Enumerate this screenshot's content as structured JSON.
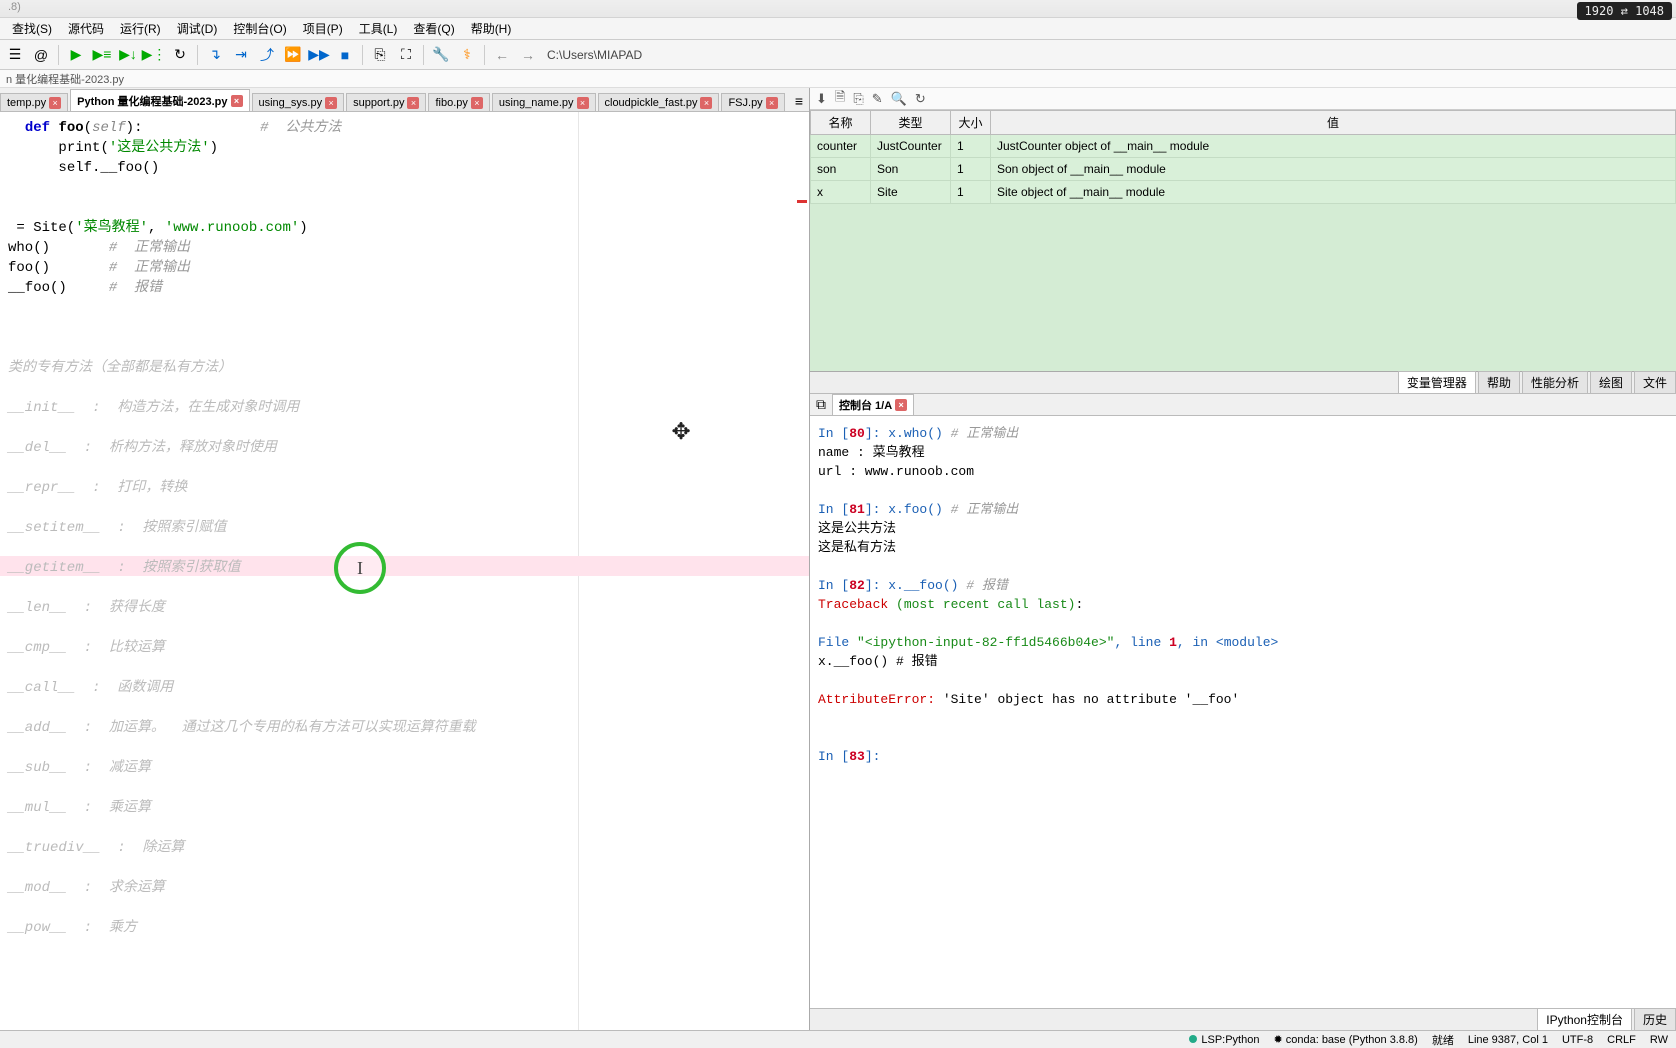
{
  "resolution_badge": "1920 ⇄ 1048",
  "titlebar_text": ".8)",
  "menu": [
    "查找(S)",
    "源代码",
    "运行(R)",
    "调试(D)",
    "控制台(O)",
    "项目(P)",
    "工具(L)",
    "查看(Q)",
    "帮助(H)"
  ],
  "path": "C:\\Users\\MIAPAD",
  "crumb": "n 量化编程基础-2023.py",
  "tabs": [
    {
      "label": "temp.py"
    },
    {
      "label": "Python 量化编程基础-2023.py",
      "active": true
    },
    {
      "label": "using_sys.py"
    },
    {
      "label": "support.py"
    },
    {
      "label": "fibo.py"
    },
    {
      "label": "using_name.py"
    },
    {
      "label": "cloudpickle_fast.py"
    },
    {
      "label": "FSJ.py"
    }
  ],
  "code": {
    "l1_def": "def",
    "l1_name": "foo",
    "l1_self": "self",
    "l1_cmt": "#  公共方法",
    "l2_print": "print",
    "l2_str": "'这是公共方法'",
    "l3": "self.__foo()",
    "l4_site": " = Site(",
    "l4_s1": "'菜鸟教程'",
    "l4_s2": "'www.runoob.com'",
    "l4_end": ")",
    "l5": "who()",
    "l5_cmt": "#  正常输出",
    "l6": "foo()",
    "l6_cmt": "#  正常输出",
    "l7": "__foo()",
    "l7_cmt": "#  报错",
    "sec": "类的专有方法（全部都是私有方法）",
    "m1": "__init__  :  构造方法，在生成对象时调用",
    "m2": "__del__  :  析构方法，释放对象时使用",
    "m3": "__repr__  :  打印，转换",
    "m4": "__setitem__  :  按照索引赋值",
    "m5": "__getitem__  :  按照索引获取值",
    "m6": "__len__  :  获得长度",
    "m7": "__cmp__  :  比较运算",
    "m8": "__call__  :  函数调用",
    "m9": "__add__  :  加运算。  通过这几个专用的私有方法可以实现运算符重载",
    "m10": "__sub__  :  减运算",
    "m11": "__mul__  :  乘运算",
    "m12": "__truediv__  :  除运算",
    "m13": "__mod__  :  求余运算",
    "m14": "__pow__  :  乘方"
  },
  "var_headers": {
    "c1": "名称",
    "c2": "类型",
    "c3": "大小",
    "c4": "值"
  },
  "vars": [
    {
      "n": "counter",
      "t": "JustCounter",
      "s": "1",
      "v": "JustCounter object of __main__ module"
    },
    {
      "n": "son",
      "t": "Son",
      "s": "1",
      "v": "Son object of __main__ module"
    },
    {
      "n": "x",
      "t": "Site",
      "s": "1",
      "v": "Site object of __main__ module"
    }
  ],
  "right_tabs": [
    "变量管理器",
    "帮助",
    "性能分析",
    "绘图",
    "文件"
  ],
  "console_tab": "控制台 1/A",
  "console": {
    "in80": "In [",
    "n80": "80",
    "in80b": "]: x.who()",
    "c80": "# 正常输出",
    "out80a": "name  :   菜鸟教程",
    "out80b": "url :   www.runoob.com",
    "in81": "In [",
    "n81": "81",
    "in81b": "]: x.foo()",
    "c81": "# 正常输出",
    "out81a": "这是公共方法",
    "out81b": "这是私有方法",
    "in82": "In [",
    "n82": "82",
    "in82b": "]: x.__foo()",
    "c82": "# 报错",
    "tb": "Traceback ",
    "tbrecent": "(most recent call last)",
    "tbcolon": ":",
    "file": "  File ",
    "filestr": "\"<ipython-input-82-ff1d5466b04e>\"",
    "fileln": ", line ",
    "ln1": "1",
    "filein": ", in ",
    "mod": "<module>",
    "callline": "    x.__foo()      # 报错",
    "err": "AttributeError:",
    "errmsg": " 'Site' object has no attribute '__foo'",
    "in83": "In [",
    "n83": "83",
    "in83b": "]:"
  },
  "bottom_right_tabs": [
    "IPython控制台",
    "历史"
  ],
  "status": {
    "lsp": "LSP:Python",
    "conda": "conda: base (Python 3.8.8)",
    "pos": "Line 9387, Col 1",
    "enc": "UTF-8",
    "eol": "CRLF",
    "rw": "RW",
    "mem": "就绪"
  }
}
